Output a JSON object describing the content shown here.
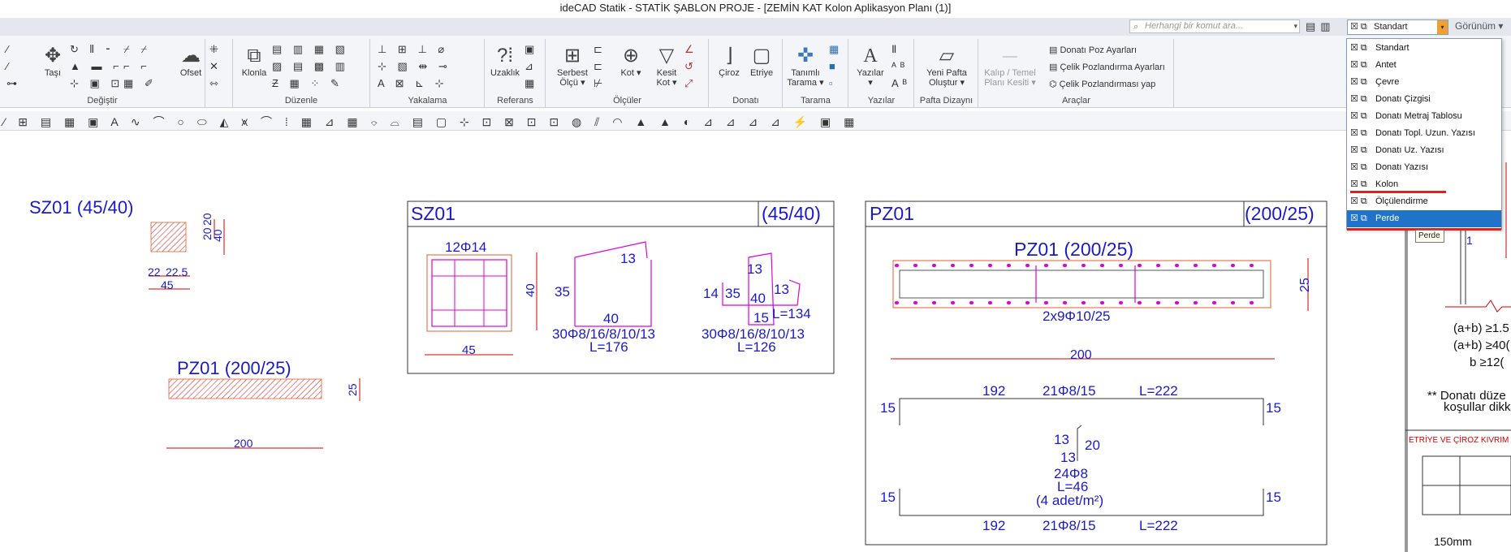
{
  "window": {
    "title": "ideCAD Statik - STATİK ŞABLON PROJE - [ZEMİN KAT Kolon Aplikasyon Planı (1)]"
  },
  "command_search": {
    "placeholder": "Herhangi bir komut ara..."
  },
  "layer_combo": {
    "value": "Standart"
  },
  "view_menu": {
    "label": "Görünüm"
  },
  "ribbon": {
    "groups": [
      {
        "name": "Değiştir",
        "buttons": [
          "Taşı",
          "Ofset"
        ]
      },
      {
        "name": "Düzenle",
        "buttons": [
          "Klonla"
        ]
      },
      {
        "name": "Yakalama",
        "buttons": []
      },
      {
        "name": "Referans",
        "buttons": [
          "Uzaklık"
        ]
      },
      {
        "name": "Ölçüler",
        "buttons": [
          "Serbest Ölçü",
          "Kot",
          "Kesit Kot"
        ]
      },
      {
        "name": "Donatı",
        "buttons": [
          "Çiroz",
          "Etriye"
        ]
      },
      {
        "name": "Tarama",
        "buttons": [
          "Tanımlı Tarama"
        ]
      },
      {
        "name": "Yazılar",
        "buttons": [
          "Yazılar"
        ]
      },
      {
        "name": "Pafta Dizaynı",
        "buttons": [
          "Yeni Pafta Oluştur"
        ]
      },
      {
        "name": "Araçlar",
        "buttons": [
          "Kalıp / Temel Planı Kesiti",
          "Donatı Poz Ayarları",
          "Çelik Pozlandırma Ayarları",
          "Çelik Pozlandırması yap"
        ]
      }
    ],
    "icon_rows": {
      "ref_small": "1.2",
      "kot_small": "1.2"
    }
  },
  "layer_dropdown": {
    "items": [
      "Standart",
      "Antet",
      "Çevre",
      "Donatı Çizgisi",
      "Donatı Metraj Tablosu",
      "Donatı Topl. Uzun. Yazısı",
      "Donatı Uz. Yazısı",
      "Donatı Yazısı",
      "Kolon",
      "Ölçülendirme",
      "Perde"
    ],
    "selected": "Perde",
    "tooltip": "Perde"
  },
  "drawing": {
    "left_col": {
      "title": "SZ01 (45/40)",
      "dims_h": [
        "22",
        "22.5",
        "45"
      ],
      "dims_v": [
        "20",
        "20",
        "40"
      ]
    },
    "left_wall": {
      "title": "PZ01 (200/25)",
      "depth": "25",
      "length": "200"
    },
    "sz01_detail": {
      "title": "SZ01",
      "size": "(45/40)",
      "rebar_label": "12Φ14",
      "width": "45",
      "height": "40",
      "stirrup1": {
        "hook": "13",
        "side": "35",
        "bottom": "40",
        "spec": "30Φ8/16/8/10/13",
        "len": "L=176"
      },
      "stirrup2": {
        "top": "13",
        "left": "14",
        "a": "35",
        "b": "40",
        "c": "13",
        "d": "15",
        "len1": "L=134",
        "spec": "30Φ8/16/8/10/13",
        "len2": "L=126"
      }
    },
    "pz01_detail": {
      "title": "PZ01",
      "size": "(200/25)",
      "heading": "PZ01 (200/25)",
      "depth": "25",
      "bars": "2x9Φ10/25",
      "length": "200",
      "top_row": [
        "192",
        "21Φ8/15",
        "L=222"
      ],
      "side_left": "15",
      "side_right": "15",
      "tie": {
        "a": "13",
        "b": "20",
        "c": "13",
        "spec": "24Φ8",
        "len": "L=46",
        "note": "(4 adet/m²)"
      },
      "bottom_row": [
        "192",
        "21Φ8/15",
        "L=222"
      ]
    },
    "right_panel": {
      "page": "1",
      "cond1": "(a+b) ≥1.5",
      "cond2": "(a+b) ≥40(",
      "cond3": "b ≥12(",
      "note1": "** Donatı düze",
      "note2": "koşullar dikk",
      "section_title": "ETRİYE VE ÇİROZ KIVRIM",
      "bottom": "150mm"
    }
  },
  "colors": {
    "drawing_text": "#1a1acc",
    "rebar": "#e000e0",
    "dim": "#d40000",
    "selection": "#1f73c9"
  }
}
